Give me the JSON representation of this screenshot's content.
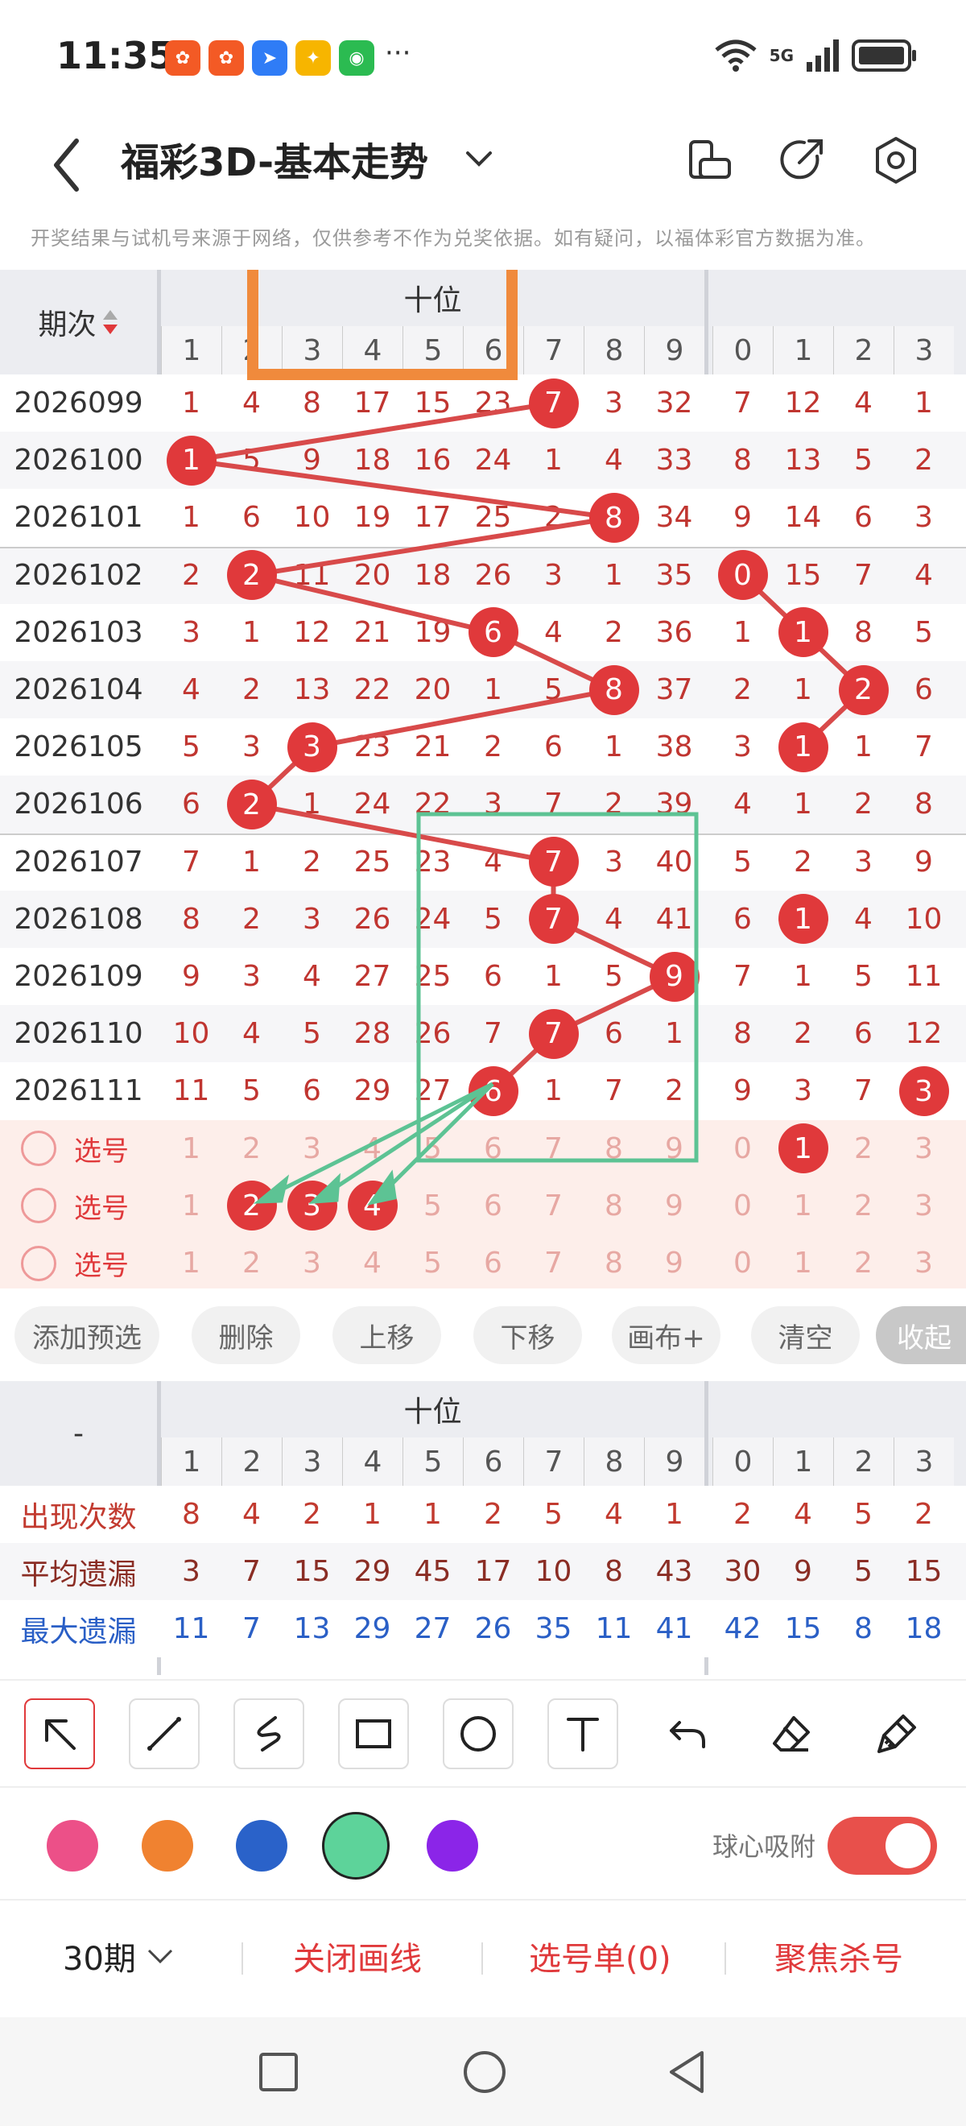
{
  "status": {
    "time": "11:35",
    "app_icons": [
      {
        "name": "kuaishou-icon",
        "glyph": "✿",
        "color": "#f35a25"
      },
      {
        "name": "kuaishou-icon-2",
        "glyph": "✿",
        "color": "#f35a25"
      },
      {
        "name": "navigation-icon",
        "glyph": "➤",
        "color": "#2f7cf6"
      },
      {
        "name": "pinwheel-icon",
        "glyph": "✦",
        "color": "#f7b500"
      },
      {
        "name": "wechat-icon",
        "glyph": "◉",
        "color": "#2bbb51"
      }
    ],
    "more": "···",
    "network": "5G"
  },
  "header": {
    "title": "福彩3D-基本走势",
    "notice": "开奖结果与试机号来源于网络，仅供参考不作为兑奖依据。如有疑问，以福体彩官方数据为准。"
  },
  "trend": {
    "period_header": "期次",
    "group_label": "十位",
    "group_cols": [
      "1",
      "2",
      "3",
      "4",
      "5",
      "6",
      "7",
      "8",
      "9"
    ],
    "next_cols": [
      "0",
      "1",
      "2",
      "3"
    ],
    "rows": [
      {
        "period": "2026099",
        "left": [
          "1",
          "4",
          "8",
          "17",
          "15",
          "23",
          "7",
          "3",
          "32"
        ],
        "right": [
          "7",
          "12",
          "4",
          "1"
        ]
      },
      {
        "period": "2026100",
        "left": [
          "1",
          "5",
          "9",
          "18",
          "16",
          "24",
          "1",
          "4",
          "33"
        ],
        "right": [
          "8",
          "13",
          "5",
          "2"
        ]
      },
      {
        "period": "2026101",
        "left": [
          "1",
          "6",
          "10",
          "19",
          "17",
          "25",
          "2",
          "8",
          "34"
        ],
        "right": [
          "9",
          "14",
          "6",
          "3"
        ]
      },
      {
        "period": "2026102",
        "left": [
          "2",
          "2",
          "11",
          "20",
          "18",
          "26",
          "3",
          "1",
          "35"
        ],
        "right": [
          "0",
          "15",
          "7",
          "4"
        ]
      },
      {
        "period": "2026103",
        "left": [
          "3",
          "1",
          "12",
          "21",
          "19",
          "6",
          "4",
          "2",
          "36"
        ],
        "right": [
          "1",
          "1",
          "8",
          "5"
        ]
      },
      {
        "period": "2026104",
        "left": [
          "4",
          "2",
          "13",
          "22",
          "20",
          "1",
          "5",
          "8",
          "37"
        ],
        "right": [
          "2",
          "1",
          "2",
          "6"
        ]
      },
      {
        "period": "2026105",
        "left": [
          "5",
          "3",
          "3",
          "23",
          "21",
          "2",
          "6",
          "1",
          "38"
        ],
        "right": [
          "3",
          "1",
          "1",
          "7"
        ]
      },
      {
        "period": "2026106",
        "left": [
          "6",
          "2",
          "1",
          "24",
          "22",
          "3",
          "7",
          "2",
          "39"
        ],
        "right": [
          "4",
          "1",
          "2",
          "8"
        ]
      },
      {
        "period": "2026107",
        "left": [
          "7",
          "1",
          "2",
          "25",
          "23",
          "4",
          "7",
          "3",
          "40"
        ],
        "right": [
          "5",
          "2",
          "3",
          "9"
        ]
      },
      {
        "period": "2026108",
        "left": [
          "8",
          "2",
          "3",
          "26",
          "24",
          "5",
          "7",
          "4",
          "41"
        ],
        "right": [
          "6",
          "1",
          "4",
          "10"
        ]
      },
      {
        "period": "2026109",
        "left": [
          "9",
          "3",
          "4",
          "27",
          "25",
          "6",
          "1",
          "5",
          "9"
        ],
        "right": [
          "7",
          "1",
          "5",
          "11"
        ]
      },
      {
        "period": "2026110",
        "left": [
          "10",
          "4",
          "5",
          "28",
          "26",
          "7",
          "7",
          "6",
          "1"
        ],
        "right": [
          "8",
          "2",
          "6",
          "12"
        ]
      },
      {
        "period": "2026111",
        "left": [
          "11",
          "5",
          "6",
          "29",
          "27",
          "6",
          "1",
          "7",
          "2"
        ],
        "right": [
          "9",
          "3",
          "7",
          "3"
        ]
      }
    ],
    "pick_label": "选号",
    "pick_rows": [
      {
        "left": [
          "1",
          "2",
          "3",
          "4",
          "5",
          "6",
          "7",
          "8",
          "9"
        ],
        "right": [
          "0",
          "1",
          "2",
          "3"
        ]
      },
      {
        "left": [
          "1",
          "2",
          "3",
          "4",
          "5",
          "6",
          "7",
          "8",
          "9"
        ],
        "right": [
          "0",
          "1",
          "2",
          "3"
        ]
      },
      {
        "left": [
          "1",
          "2",
          "3",
          "4",
          "5",
          "6",
          "7",
          "8",
          "9"
        ],
        "right": [
          "0",
          "1",
          "2",
          "3"
        ]
      }
    ]
  },
  "buttons": [
    "添加预选",
    "删除",
    "上移",
    "下移",
    "画布+",
    "清空",
    "收起"
  ],
  "stats": {
    "dash": "-",
    "group_label": "十位",
    "rows": [
      {
        "label": "出现次数",
        "color": "#c23a2f",
        "left": [
          "8",
          "4",
          "2",
          "1",
          "1",
          "2",
          "5",
          "4",
          "1"
        ],
        "right": [
          "2",
          "4",
          "5",
          "2"
        ]
      },
      {
        "label": "平均遗漏",
        "color": "#8a2d24",
        "left": [
          "3",
          "7",
          "15",
          "29",
          "45",
          "17",
          "10",
          "8",
          "43"
        ],
        "right": [
          "30",
          "9",
          "5",
          "15"
        ]
      },
      {
        "label": "最大遗漏",
        "color": "#2a5fc6",
        "left": [
          "11",
          "7",
          "13",
          "29",
          "27",
          "26",
          "35",
          "11",
          "41"
        ],
        "right": [
          "42",
          "15",
          "8",
          "18"
        ]
      }
    ]
  },
  "tools": {
    "colors": [
      "#ec5088",
      "#f08230",
      "#2a62c9",
      "#5dd39a",
      "#8b25e8"
    ],
    "snap_label": "球心吸附"
  },
  "bottom": {
    "periods": "30期",
    "close_lines": "关闭画线",
    "pick_list": "选号单(0)",
    "focus_kill": "聚焦杀号"
  }
}
